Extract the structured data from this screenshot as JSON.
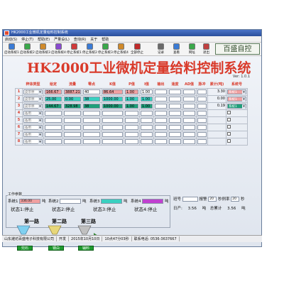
{
  "window": {
    "title": "HK2000工业微机定量给料控制系统"
  },
  "menu": [
    "启动(S)",
    "停止(T)",
    "帮助(E)",
    "严量设(L)",
    "查询(R)",
    "关于",
    "帮助"
  ],
  "toolbar": [
    {
      "label": "启动系统1",
      "color": "#3a7bd5"
    },
    {
      "label": "启动系统2",
      "color": "#3aa84a"
    },
    {
      "label": "启动系统3",
      "color": "#d08a2a"
    },
    {
      "label": "启动系统4",
      "color": "#8a4ad0"
    },
    {
      "label": "停止系统1",
      "color": "#d03a3a"
    },
    {
      "label": "停止系统2",
      "color": "#3a7bd5"
    },
    {
      "label": "停止系统3",
      "color": "#3aa84a"
    },
    {
      "label": "停止系统4",
      "color": "#d08a2a"
    },
    {
      "label": "全部停止",
      "color": "#c02a2a"
    },
    {
      "label": "记录",
      "color": "#6a6a6a"
    },
    {
      "label": "查看",
      "color": "#3a7bd5"
    },
    {
      "label": "网址",
      "color": "#3aa84a"
    },
    {
      "label": "退出",
      "color": "#c04040"
    }
  ],
  "brand": "百盛自控",
  "main": {
    "title": "HK2000工业微机定量给料控制系统",
    "version": "Ver: 1.0.1"
  },
  "table": {
    "headers": [
      "",
      "秤体类型",
      "给定",
      "流量",
      "零点",
      "K值",
      "P值",
      "I值",
      "输出",
      "速度",
      "AD值",
      "脉冲",
      "累计(吨)",
      "系统号"
    ],
    "rows": [
      {
        "no": "1",
        "type": "皮带秤",
        "given": "166.67",
        "flow": "3887.21",
        "zero": "40",
        "k": "86.64",
        "p": "1.00",
        "i": "1.00",
        "out": "",
        "speed": "",
        "ad": "",
        "pulse": "",
        "total": "3.30",
        "sys": "系统1"
      },
      {
        "no": "2",
        "type": "皮带秤",
        "given": "25.00",
        "flow": "0.00",
        "zero": "38",
        "k": "1000.00",
        "p": "1.00",
        "i": "1.00",
        "out": "",
        "speed": "",
        "ad": "",
        "pulse": "",
        "total": "0.00",
        "sys": "系统1"
      },
      {
        "no": "3",
        "type": "皮带秤",
        "given": "144.67",
        "flow": "328.98",
        "zero": "38",
        "k": "1000.00",
        "p": "1.00",
        "i": "1.00",
        "out": "",
        "speed": "",
        "ad": "",
        "pulse": "",
        "total": "0.19",
        "sys": "系统1"
      },
      {
        "no": "4",
        "type": "备用",
        "given": "",
        "flow": "",
        "zero": "",
        "k": "",
        "p": "",
        "i": "",
        "out": "",
        "speed": "",
        "ad": "",
        "pulse": "",
        "total": "",
        "sys": ""
      },
      {
        "no": "5",
        "type": "备用",
        "given": "",
        "flow": "",
        "zero": "",
        "k": "",
        "p": "",
        "i": "",
        "out": "",
        "speed": "",
        "ad": "",
        "pulse": "",
        "total": "",
        "sys": ""
      },
      {
        "no": "6",
        "type": "备用",
        "given": "",
        "flow": "",
        "zero": "",
        "k": "",
        "p": "",
        "i": "",
        "out": "",
        "speed": "",
        "ad": "",
        "pulse": "",
        "total": "",
        "sys": ""
      },
      {
        "no": "7",
        "type": "备用",
        "given": "",
        "flow": "",
        "zero": "",
        "k": "",
        "p": "",
        "i": "",
        "out": "",
        "speed": "",
        "ad": "",
        "pulse": "",
        "total": "",
        "sys": ""
      },
      {
        "no": "8",
        "type": "备用",
        "given": "",
        "flow": "",
        "zero": "",
        "k": "",
        "p": "",
        "i": "",
        "out": "",
        "speed": "",
        "ad": "",
        "pulse": "",
        "total": "",
        "sys": ""
      }
    ]
  },
  "params": {
    "title": "工作参数",
    "sys1": {
      "label": "系统1",
      "value": "336.00",
      "unit": "吨"
    },
    "sys2": {
      "label": "系统2",
      "value": "",
      "unit": "吨"
    },
    "sys3": {
      "label": "系统3",
      "value": "",
      "unit": "吨"
    },
    "sys4": {
      "label": "系统4",
      "value": "",
      "unit": "吨"
    },
    "status": [
      "状态1:停止",
      "状态2:停止",
      "状态3:停止",
      "状态4:停止"
    ]
  },
  "right": {
    "shift_label": "班号",
    "shift_value": "",
    "alarm_label": "报警",
    "alarm_value": "20",
    "sample_label": "秒例率",
    "sample_value": "20",
    "sample_unit": "秒",
    "daily_label": "日产:",
    "daily_value": "3.56",
    "daily_unit": "吨",
    "total_label": "总累计",
    "total_value": "3.56",
    "total_unit": "吨"
  },
  "lines": [
    "第一路",
    "第二路",
    "第三路"
  ],
  "buttons": [
    "兜石",
    "钢白",
    "辅料"
  ],
  "status": {
    "company": "山东潍坊百盛电子科技有限公司",
    "mode": "开发",
    "date": "2015年10月10日",
    "time": "10点47分03秒",
    "phone": "联系电话: 0536-3637667"
  }
}
